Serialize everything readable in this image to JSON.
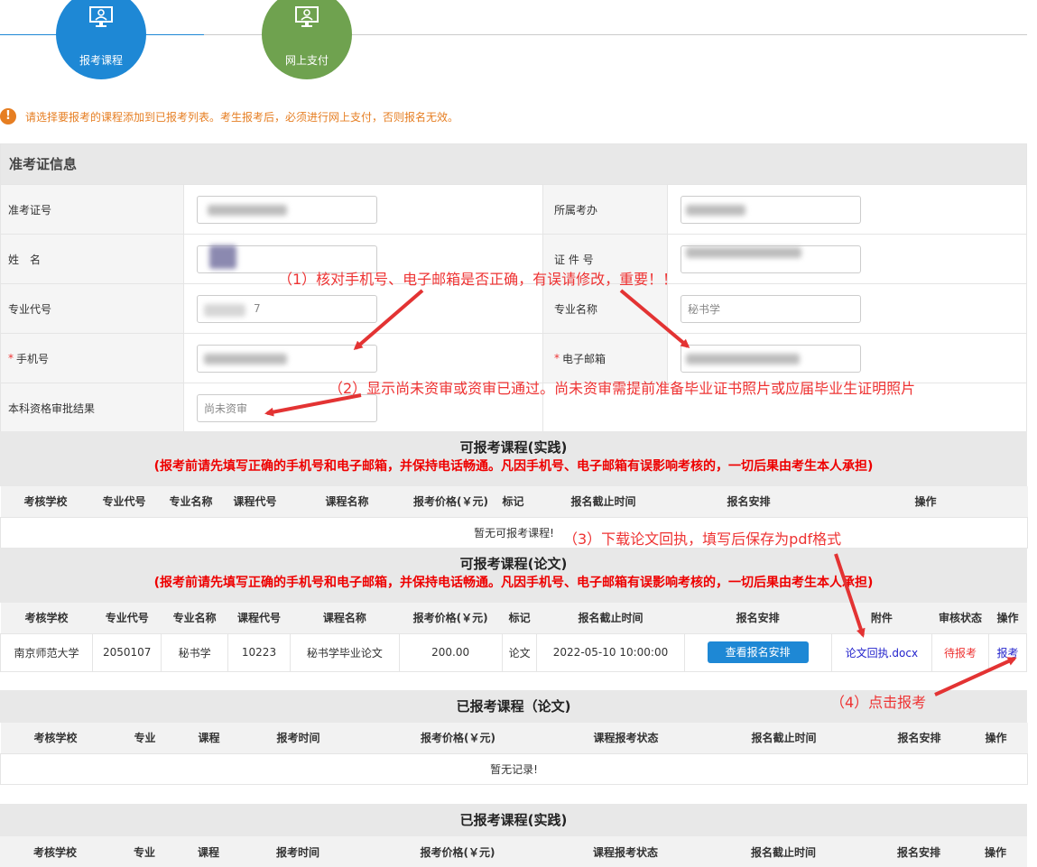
{
  "steps": [
    {
      "label": "报考课程",
      "color": "#1e88d5",
      "icon": "monitor-user-icon"
    },
    {
      "label": "网上支付",
      "color": "#6fa24f",
      "icon": "monitor-user-icon"
    }
  ],
  "notice": "请选择要报考的课程添加到已报考列表。考生报考后，必须进行网上支付，否则报名无效。",
  "info": {
    "title": "准考证信息",
    "fields": {
      "ticket_label": "准考证号",
      "office_label": "所属考办",
      "name_label": "姓　名",
      "id_label": "证 件 号",
      "major_code_label": "专业代号",
      "major_name_label": "专业名称",
      "major_name_value": "秘书学",
      "major_code_partial": "7",
      "phone_label": "手机号",
      "email_label": "电子邮箱",
      "review_label": "本科资格审批结果",
      "review_value": "尚未资审"
    }
  },
  "practice": {
    "title": "可报考课程(实践)",
    "warning": "(报考前请先填写正确的手机号和电子邮箱，并保持电话畅通。凡因手机号、电子邮箱有误影响考核的，一切后果由考生本人承担)",
    "headers": [
      "考核学校",
      "专业代号",
      "专业名称",
      "课程代号",
      "课程名称",
      "报考价格(￥元)",
      "标记",
      "报名截止时间",
      "报名安排",
      "操作"
    ],
    "empty": "暂无可报考课程!"
  },
  "thesis": {
    "title": "可报考课程(论文)",
    "warning": "(报考前请先填写正确的手机号和电子邮箱，并保持电话畅通。凡因手机号、电子邮箱有误影响考核的，一切后果由考生本人承担)",
    "headers": [
      "考核学校",
      "专业代号",
      "专业名称",
      "课程代号",
      "课程名称",
      "报考价格(￥元)",
      "标记",
      "报名截止时间",
      "报名安排",
      "附件",
      "审核状态",
      "操作"
    ],
    "row": {
      "school": "南京师范大学",
      "major_code": "2050107",
      "major_name": "秘书学",
      "course_code": "10223",
      "course_name": "秘书学毕业论文",
      "price": "200.00",
      "mark": "论文",
      "deadline": "2022-05-10 10:00:00",
      "arrange_btn": "查看报名安排",
      "attachment": "论文回执.docx",
      "status": "待报考",
      "action": "报考"
    }
  },
  "registered_thesis": {
    "title": "已报考课程（论文)",
    "headers": [
      "考核学校",
      "专业",
      "课程",
      "报考时间",
      "报考价格(￥元)",
      "课程报考状态",
      "报名截止时间",
      "报名安排",
      "操作"
    ],
    "empty": "暂无记录!"
  },
  "registered_practice": {
    "title": "已报考课程(实践)",
    "headers": [
      "考核学校",
      "专业",
      "课程",
      "报考时间",
      "报考价格(￥元)",
      "课程报考状态",
      "报名截止时间",
      "报名安排",
      "操作"
    ]
  },
  "annotations": {
    "a1": "（1）核对手机号、电子邮箱是否正确，有误请修改，重要！！",
    "a2": "（2）显示尚未资审或资审已通过。尚未资审需提前准备毕业证书照片或应届毕业生证明照片",
    "a3": "（3）下载论文回执，填写后保存为pdf格式",
    "a4": "（4）点击报考",
    "color": "#e33333"
  }
}
